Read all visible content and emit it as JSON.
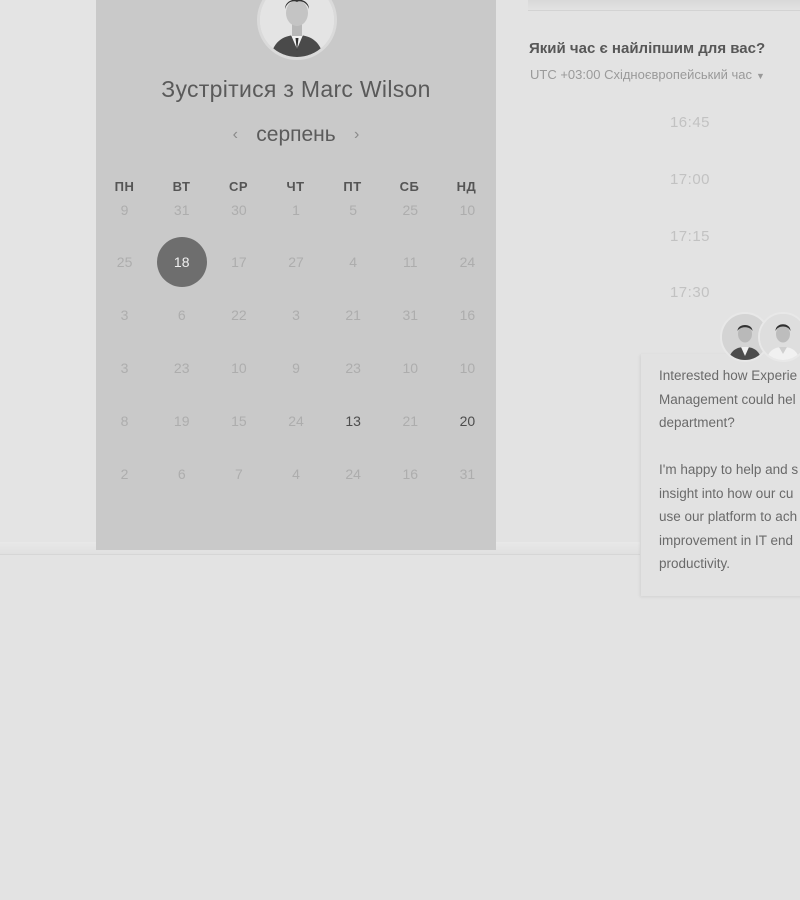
{
  "meeting": {
    "title": "Зустрітися з Marc Wilson"
  },
  "calendar": {
    "month": "серпень",
    "prev_icon": "chevron-left-icon",
    "next_icon": "chevron-right-icon",
    "weekdays": [
      "ПН",
      "ВТ",
      "СР",
      "ЧТ",
      "ПТ",
      "СБ",
      "НД"
    ],
    "weeks": [
      [
        "9",
        "31",
        "30",
        "1",
        "5",
        "25",
        "10"
      ],
      [
        "25",
        "18",
        "17",
        "27",
        "4",
        "11",
        "24"
      ],
      [
        "3",
        "6",
        "22",
        "3",
        "21",
        "31",
        "16"
      ],
      [
        "3",
        "23",
        "10",
        "9",
        "23",
        "10",
        "10"
      ],
      [
        "8",
        "19",
        "15",
        "24",
        "13",
        "21",
        "20"
      ],
      [
        "2",
        "6",
        "7",
        "4",
        "24",
        "16",
        "31"
      ]
    ],
    "selected_day": "18",
    "available_days": [
      "13",
      "20"
    ]
  },
  "scheduler": {
    "question": "Який час є найліпшим для вас?",
    "timezone": "UTC +03:00 Східноєвропейський час",
    "slots": [
      "16:45",
      "17:00",
      "17:15",
      "17:30"
    ]
  },
  "info": {
    "paragraph1": [
      "Interested how Experie",
      "Management could hel",
      "department?"
    ],
    "paragraph2": [
      "I'm happy to help and s",
      "insight into how our cu",
      "use our platform to ach",
      "improvement in IT end",
      "productivity."
    ]
  },
  "colors": {
    "panel_bg": "#c9c9c9",
    "page_bg": "#e3e3e3",
    "selected_day_bg": "#6e6e6e"
  }
}
